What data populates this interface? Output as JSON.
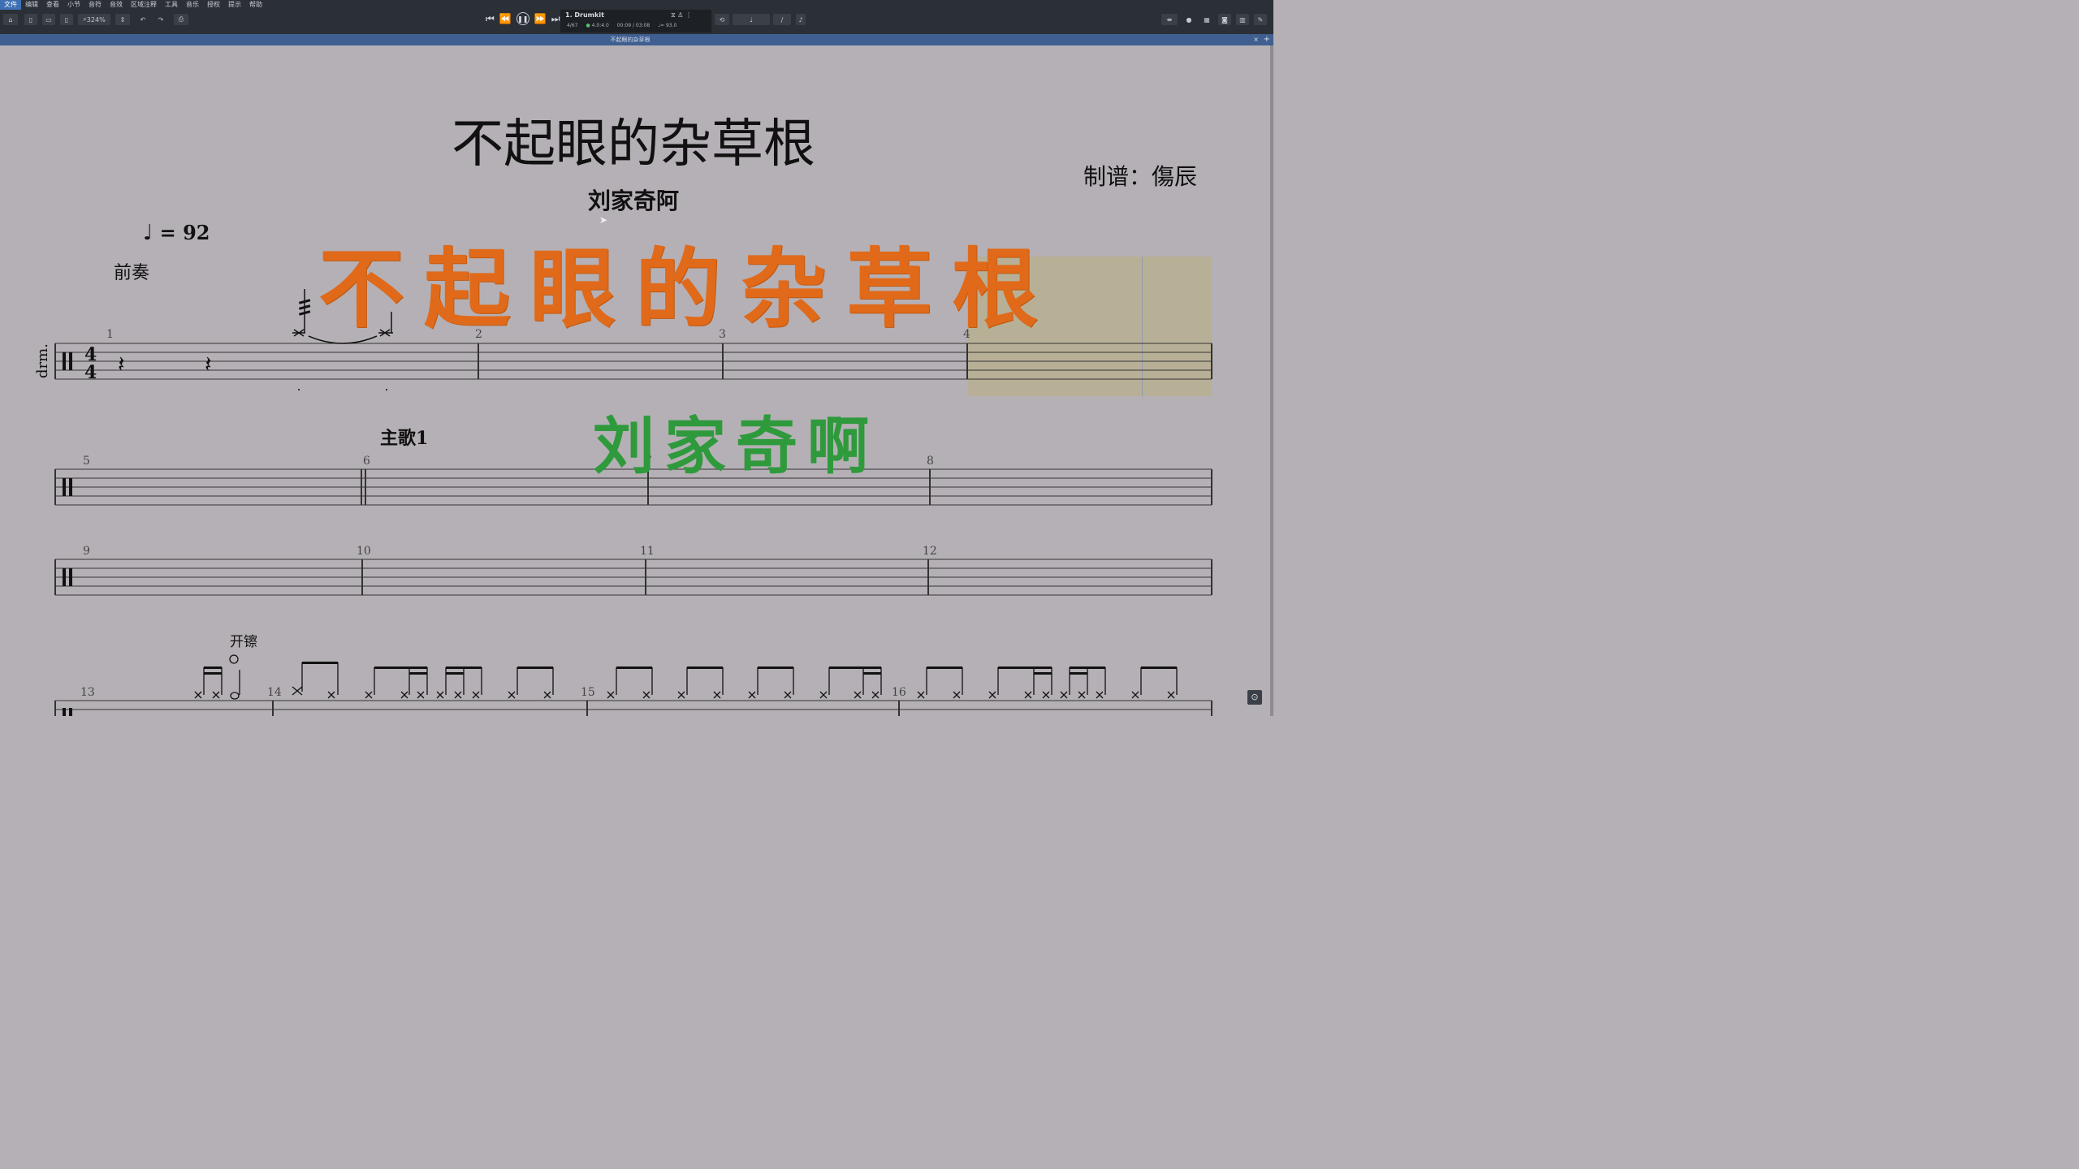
{
  "menu": [
    "文件",
    "编辑",
    "查看",
    "小节",
    "音符",
    "音效",
    "区域注释",
    "工具",
    "音乐",
    "授权",
    "提示",
    "帮助"
  ],
  "toolbar": {
    "zoom": "324%"
  },
  "transport": {
    "instrument": "1. Drumkit",
    "bar_pos": "4/67",
    "beat_pos": "4.0:4.0",
    "time": "00:09 / 03:08",
    "tempo_readout": "♩= 93.0"
  },
  "tab": {
    "title": "不起眼的杂草根"
  },
  "score": {
    "title": "不起眼的杂草根",
    "composer": "刘家奇阿",
    "arranger": "制谱：傷辰",
    "tempo_note": "♩",
    "tempo_value": "= 92",
    "instrument_abbr": "drm.",
    "sections": {
      "intro": "前奏",
      "verse": "主歌1",
      "open_hihat": "开镲"
    },
    "measures_row1": [
      "1",
      "2",
      "3",
      "4"
    ],
    "measures_row2": [
      "5",
      "6",
      "7",
      "8"
    ],
    "measures_row3": [
      "9",
      "10",
      "11",
      "12"
    ],
    "measures_row4": [
      "13",
      "14",
      "15",
      "16"
    ]
  },
  "overlay": {
    "title_text": "不起眼的杂草根",
    "artist_text": "刘家奇啊"
  },
  "colors": {
    "page_bg": "#b5b0b5",
    "overlay_title": "#e06a1a",
    "overlay_artist": "#2e9a3c",
    "chrome": "#2b2f36"
  }
}
